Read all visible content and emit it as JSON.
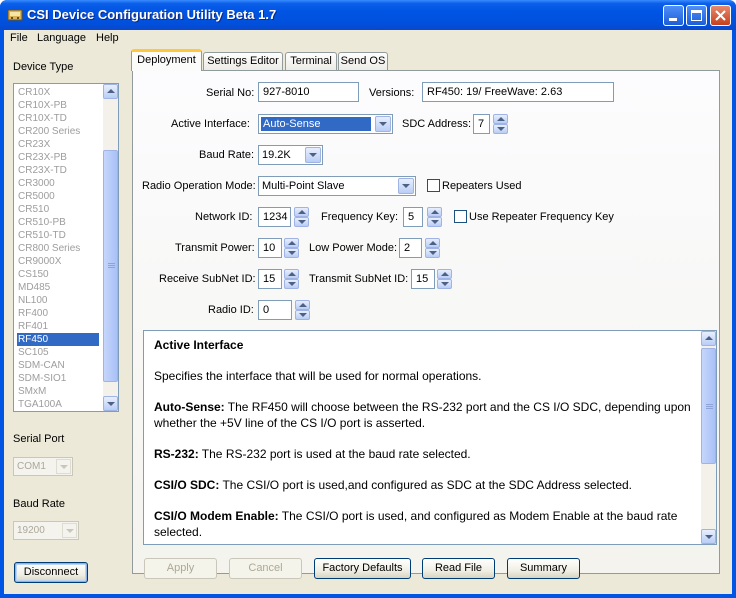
{
  "window": {
    "title": "CSI Device Configuration Utility Beta 1.7"
  },
  "menu": {
    "file": "File",
    "language": "Language",
    "help": "Help"
  },
  "sidebar": {
    "device_type_label": "Device Type",
    "devices": [
      "CR10X",
      "CR10X-PB",
      "CR10X-TD",
      "CR200 Series",
      "CR23X",
      "CR23X-PB",
      "CR23X-TD",
      "CR3000",
      "CR5000",
      "CR510",
      "CR510-PB",
      "CR510-TD",
      "CR800 Series",
      "CR9000X",
      "CS150",
      "MD485",
      "NL100",
      "RF400",
      "RF401",
      "RF450",
      "SC105",
      "SDM-CAN",
      "SDM-SIO1",
      "SMxM",
      "TGA100A"
    ],
    "selected_device": "RF450",
    "serial_port_label": "Serial Port",
    "serial_port_value": "COM1",
    "baud_rate_label": "Baud Rate",
    "baud_rate_value": "19200",
    "disconnect_label": "Disconnect"
  },
  "tabs": [
    "Deployment",
    "Settings Editor",
    "Terminal",
    "Send OS"
  ],
  "form": {
    "serial_no_label": "Serial No:",
    "serial_no_value": "927-8010",
    "versions_label": "Versions:",
    "versions_value": "RF450: 19/ FreeWave: 2.63",
    "active_interface_label": "Active Interface:",
    "active_interface_value": "Auto-Sense",
    "sdc_address_label": "SDC Address:",
    "sdc_address_value": "7",
    "baud_rate_label": "Baud Rate:",
    "baud_rate_value": "19.2K",
    "radio_mode_label": "Radio Operation Mode:",
    "radio_mode_value": "Multi-Point Slave",
    "repeaters_used_label": "Repeaters Used",
    "network_id_label": "Network ID:",
    "network_id_value": "1234",
    "frequency_key_label": "Frequency Key:",
    "frequency_key_value": "5",
    "use_repeater_freq_label": "Use Repeater Frequency Key",
    "transmit_power_label": "Transmit Power:",
    "transmit_power_value": "10",
    "low_power_mode_label": "Low Power Mode:",
    "low_power_mode_value": "2",
    "receive_subnet_label": "Receive SubNet ID:",
    "receive_subnet_value": "15",
    "transmit_subnet_label": "Transmit SubNet ID:",
    "transmit_subnet_value": "15",
    "radio_id_label": "Radio ID:",
    "radio_id_value": "0"
  },
  "help": {
    "title": "Active Interface",
    "intro": "Specifies the interface that will be used for normal operations.",
    "entries": [
      {
        "term": "Auto-Sense:",
        "text": " The RF450 will choose between the RS-232 port and the CS I/O SDC, depending upon whether the +5V line of the CS I/O port is asserted."
      },
      {
        "term": "RS-232:",
        "text": " The RS-232 port is used at the baud rate selected."
      },
      {
        "term": "CSI/O SDC:",
        "text": " The CSI/O port is used,and configured as SDC at the SDC Address selected."
      },
      {
        "term": "CSI/O Modem Enable:",
        "text": " The CSI/O port is used, and configured as Modem Enable at the baud rate selected."
      }
    ]
  },
  "buttons": {
    "apply": "Apply",
    "cancel": "Cancel",
    "factory_defaults": "Factory Defaults",
    "read_file": "Read File",
    "summary": "Summary"
  }
}
